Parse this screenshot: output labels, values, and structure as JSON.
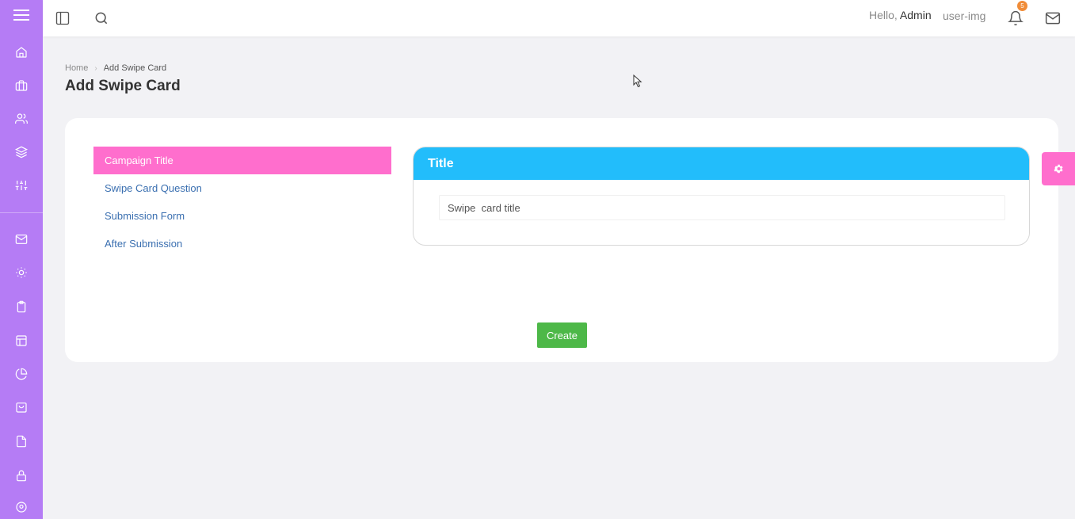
{
  "header": {
    "greeting": "Hello,",
    "user_name": "Admin",
    "user_img_alt": "user-img",
    "notification_count": "5"
  },
  "breadcrumb": {
    "home": "Home",
    "current": "Add Swipe Card"
  },
  "page": {
    "title": "Add Swipe Card"
  },
  "steps": [
    {
      "label": "Campaign Title",
      "active": true
    },
    {
      "label": "Swipe Card Question",
      "active": false
    },
    {
      "label": "Submission Form",
      "active": false
    },
    {
      "label": "After Submission",
      "active": false
    }
  ],
  "title_section": {
    "heading": "Title",
    "input_value": "Swipe  card title"
  },
  "actions": {
    "create_label": "Create"
  },
  "sidebar": {
    "icons": [
      "home-icon",
      "briefcase-icon",
      "users-icon",
      "layers-icon",
      "sliders-icon",
      "mail-icon",
      "sun-icon",
      "clipboard-icon",
      "layout-icon",
      "pie-chart-icon",
      "shopping-bag-icon",
      "file-icon",
      "lock-icon",
      "map-pin-icon"
    ]
  },
  "colors": {
    "sidebar": "#b57cf5",
    "active_step": "#ff6ecd",
    "title_header": "#22bdfb",
    "create_button": "#4db848",
    "badge": "#f08c38"
  }
}
